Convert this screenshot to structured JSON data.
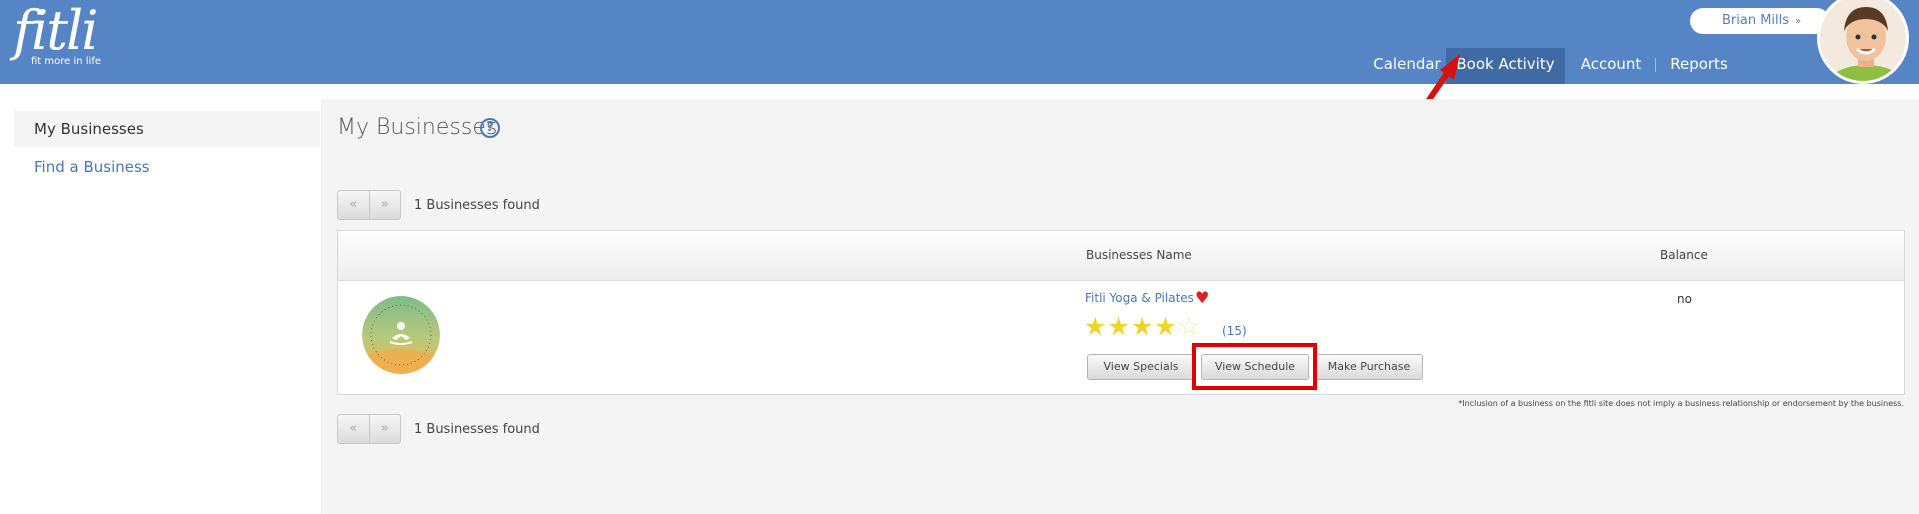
{
  "logo": {
    "word": "fitli",
    "tagline": "fit more in life"
  },
  "user": {
    "name": "Brian Mills",
    "chevron": "»"
  },
  "nav": {
    "items": [
      {
        "label": "Calendar"
      },
      {
        "label": "Book Activity",
        "active": true
      },
      {
        "label": "Account"
      },
      {
        "label": "Reports"
      }
    ]
  },
  "sidebar": {
    "items": [
      {
        "label": "My Businesses",
        "active": true
      },
      {
        "label": "Find a Business"
      }
    ]
  },
  "main": {
    "title": "My Businesses",
    "help": "?",
    "pager": {
      "prev": "«",
      "next": "»"
    },
    "found_top": "1 Businesses found",
    "found_bottom": "1 Businesses found",
    "table": {
      "headers": {
        "name": "Businesses Name",
        "balance": "Balance"
      },
      "rows": [
        {
          "name": "Fitli Yoga & Pilates",
          "logo_text": "FITLI YOGA & PILATES",
          "rating": 4,
          "rating_max": 5,
          "rating_count": "(15)",
          "balance": "no",
          "buttons": {
            "specials": "View Specials",
            "schedule": "View Schedule",
            "purchase": "Make Purchase"
          }
        }
      ]
    },
    "disclaimer": "*Inclusion of a business on the fitli site does not imply a business relationship or endorsement by the business."
  },
  "colors": {
    "header": "#5585c4",
    "nav_active": "#3f6aa3",
    "link": "#4b77b5",
    "highlight": "#e00000",
    "star": "#f0d42a",
    "heart": "#e02020"
  },
  "icons": {
    "help": "help-circle-icon",
    "heart": "heart-icon",
    "star": "star-icon",
    "arrow": "annotation-arrow-icon"
  }
}
